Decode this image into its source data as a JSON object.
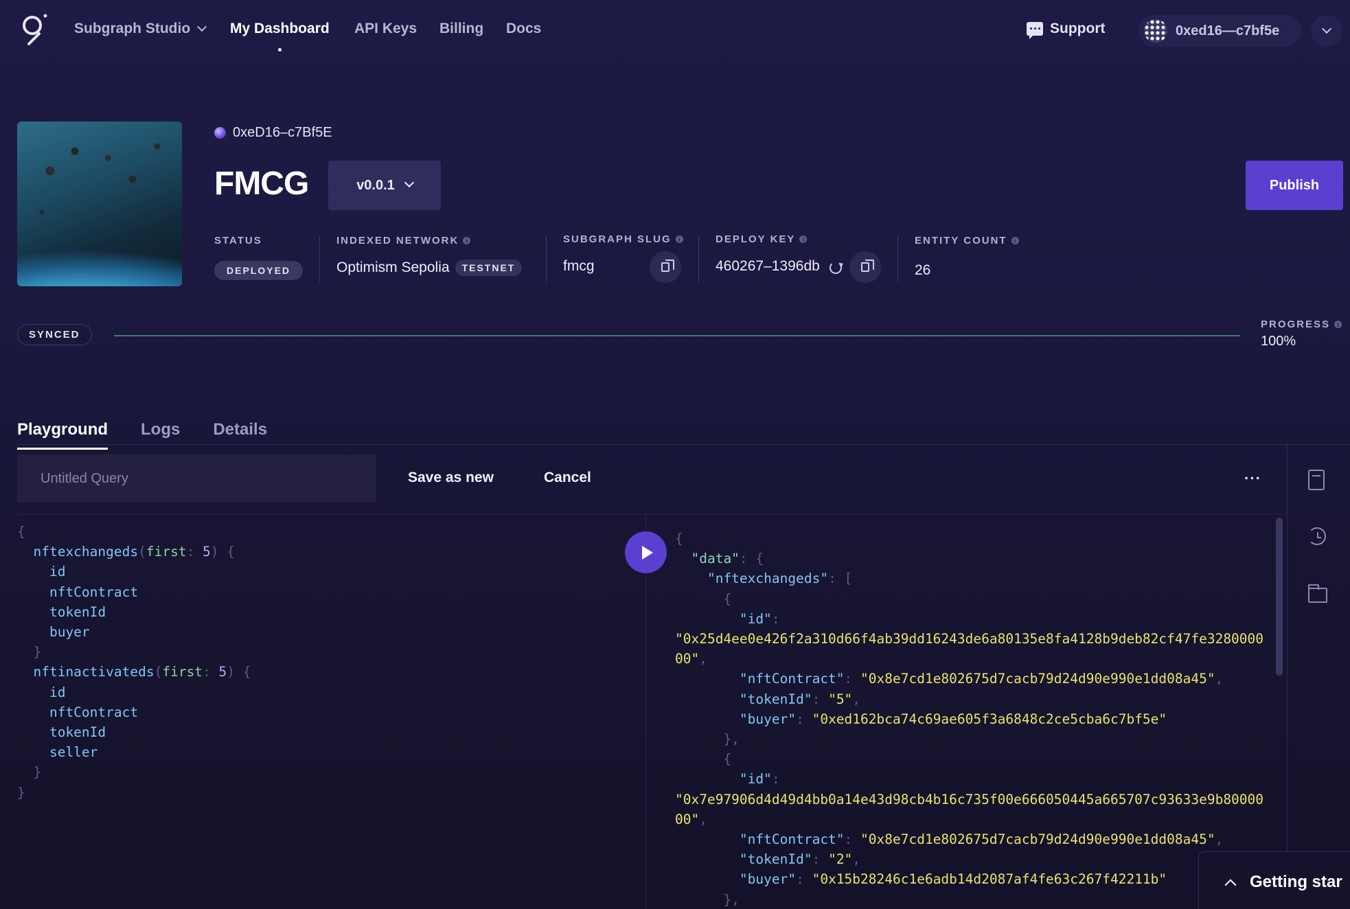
{
  "nav": {
    "studio_label": "Subgraph Studio",
    "items": [
      "My Dashboard",
      "API Keys",
      "Billing",
      "Docs"
    ],
    "support_label": "Support",
    "account_label": "0xed16—c7bf5e"
  },
  "subgraph": {
    "owner": "0xeD16–c7Bf5E",
    "title": "FMCG",
    "version": "v0.0.1",
    "publish_label": "Publish",
    "status_label": "STATUS",
    "status_value": "DEPLOYED",
    "network_label": "INDEXED NETWORK",
    "network_value": "Optimism Sepolia",
    "network_badge": "TESTNET",
    "slug_label": "SUBGRAPH SLUG",
    "slug_value": "fmcg",
    "deploy_key_label": "DEPLOY KEY",
    "deploy_key_value": "460267–1396db",
    "entity_count_label": "ENTITY COUNT",
    "entity_count_value": "26"
  },
  "sync": {
    "badge": "SYNCED",
    "progress_label": "PROGRESS",
    "progress_value": "100%",
    "progress_fraction": 1.0,
    "bar_color": "#3b7c68"
  },
  "tabs": [
    "Playground",
    "Logs",
    "Details"
  ],
  "playground": {
    "query_placeholder": "Untitled Query",
    "save_label": "Save as new",
    "cancel_label": "Cancel",
    "more_label": "···",
    "query_lines": [
      [
        [
          "pun",
          "{"
        ]
      ],
      [
        [
          "fld",
          "  nftexchangeds"
        ],
        [
          "pun",
          "("
        ],
        [
          "arg",
          "first"
        ],
        [
          "pun",
          ": "
        ],
        [
          "num",
          "5"
        ],
        [
          "pun",
          ") {"
        ]
      ],
      [
        [
          "fld",
          "    id"
        ]
      ],
      [
        [
          "fld",
          "    nftContract"
        ]
      ],
      [
        [
          "fld",
          "    tokenId"
        ]
      ],
      [
        [
          "fld",
          "    buyer"
        ]
      ],
      [
        [
          "pun",
          "  }"
        ]
      ],
      [
        [
          "fld",
          "  nftinactivateds"
        ],
        [
          "pun",
          "("
        ],
        [
          "arg",
          "first"
        ],
        [
          "pun",
          ": "
        ],
        [
          "num",
          "5"
        ],
        [
          "pun",
          ") {"
        ]
      ],
      [
        [
          "fld",
          "    id"
        ]
      ],
      [
        [
          "fld",
          "    nftContract"
        ]
      ],
      [
        [
          "fld",
          "    tokenId"
        ]
      ],
      [
        [
          "fld",
          "    seller"
        ]
      ],
      [
        [
          "pun",
          "  }"
        ]
      ],
      [
        [
          "pun",
          "}"
        ]
      ]
    ],
    "result_lines": [
      [
        [
          "pun",
          "{"
        ]
      ],
      [
        [
          "dkey",
          "  \"data\""
        ],
        [
          "pun",
          ": {"
        ]
      ],
      [
        [
          "key",
          "    \"nftexchangeds\""
        ],
        [
          "pun",
          ": ["
        ]
      ],
      [
        [
          "pun",
          "      {"
        ]
      ],
      [
        [
          "key",
          "        \"id\""
        ],
        [
          "pun",
          ":"
        ]
      ],
      [
        [
          "str",
          "\"0x25d4ee0e426f2a310d66f4ab39dd16243de6a80135e8fa4128b9deb82cf47fe3280000"
        ]
      ],
      [
        [
          "str",
          "00\""
        ],
        [
          "pun",
          ","
        ]
      ],
      [
        [
          "key",
          "        \"nftContract\""
        ],
        [
          "pun",
          ": "
        ],
        [
          "str",
          "\"0x8e7cd1e802675d7cacb79d24d90e990e1dd08a45\""
        ],
        [
          "pun",
          ","
        ]
      ],
      [
        [
          "key",
          "        \"tokenId\""
        ],
        [
          "pun",
          ": "
        ],
        [
          "str",
          "\"5\""
        ],
        [
          "pun",
          ","
        ]
      ],
      [
        [
          "key",
          "        \"buyer\""
        ],
        [
          "pun",
          ": "
        ],
        [
          "str",
          "\"0xed162bca74c69ae605f3a6848c2ce5cba6c7bf5e\""
        ]
      ],
      [
        [
          "pun",
          "      },"
        ]
      ],
      [
        [
          "pun",
          "      {"
        ]
      ],
      [
        [
          "key",
          "        \"id\""
        ],
        [
          "pun",
          ":"
        ]
      ],
      [
        [
          "str",
          "\"0x7e97906d4d49d4bb0a14e43d98cb4b16c735f00e666050445a665707c93633e9b80000"
        ]
      ],
      [
        [
          "str",
          "00\""
        ],
        [
          "pun",
          ","
        ]
      ],
      [
        [
          "key",
          "        \"nftContract\""
        ],
        [
          "pun",
          ": "
        ],
        [
          "str",
          "\"0x8e7cd1e802675d7cacb79d24d90e990e1dd08a45\""
        ],
        [
          "pun",
          ","
        ]
      ],
      [
        [
          "key",
          "        \"tokenId\""
        ],
        [
          "pun",
          ": "
        ],
        [
          "str",
          "\"2\""
        ],
        [
          "pun",
          ","
        ]
      ],
      [
        [
          "key",
          "        \"buyer\""
        ],
        [
          "pun",
          ": "
        ],
        [
          "str",
          "\"0x15b28246c1e6adb14d2087af4fe63c267f42211b\""
        ]
      ],
      [
        [
          "pun",
          "      },"
        ]
      ]
    ]
  },
  "getting_started": "Getting star",
  "icons": {
    "logo": "graph-logo-icon",
    "support": "chat-bubble-icon",
    "copy": "copy-icon",
    "refresh": "refresh-icon",
    "run": "play-icon",
    "saved_queries": "document-icon",
    "history": "history-icon",
    "folder": "folder-icon"
  },
  "colors": {
    "accent": "#5a3fd1",
    "background": "#1b1940"
  }
}
